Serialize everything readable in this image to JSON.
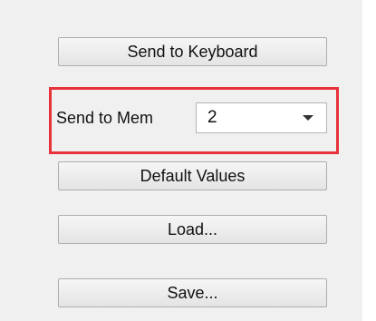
{
  "actions": {
    "send_to_keyboard_label": "Send to Keyboard",
    "default_values_label": "Default Values",
    "load_label": "Load...",
    "save_label": "Save..."
  },
  "memory": {
    "label": "Send to Mem",
    "selected_value": "2"
  },
  "highlight_color": "#e8323a"
}
